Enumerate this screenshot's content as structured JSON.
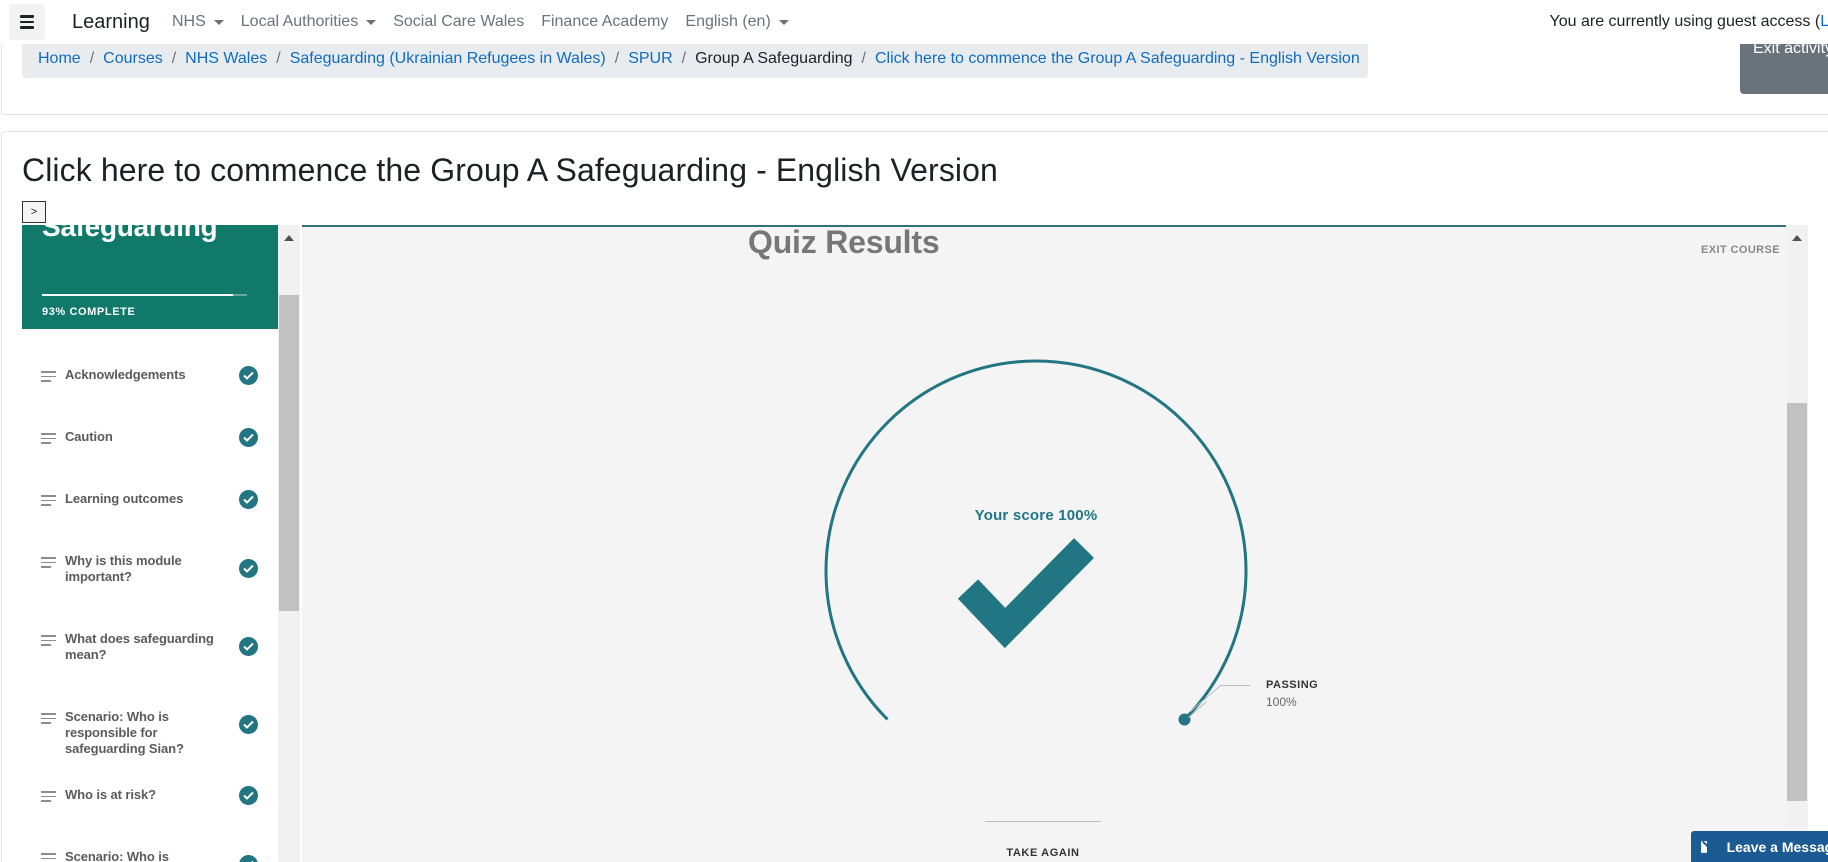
{
  "navbar": {
    "brand": "Learning",
    "menu": [
      "NHS",
      "Local Authorities",
      "Social Care Wales",
      "Finance Academy",
      "English (en)"
    ],
    "guest_text": "You are currently using guest access (",
    "guest_link": "Lo"
  },
  "breadcrumb": [
    "Home",
    "Courses",
    "NHS Wales",
    "Safeguarding (Ukrainian Refugees in Wales)",
    "SPUR",
    "Group A Safeguarding",
    "Click here to commence the Group A Safeguarding - English Version"
  ],
  "exit_activity": "Exit activity",
  "page_title": "Click here to commence the Group A Safeguarding - English Version",
  "toggle_label": ">",
  "course": {
    "title": "Safeguarding",
    "progress": 0.93,
    "complete_text": "93% COMPLETE",
    "lessons": [
      "Acknowledgements",
      "Caution",
      "Learning outcomes",
      "Why is this module important?",
      "What does safeguarding mean?",
      "Scenario: Who is responsible for safeguarding Sian?",
      "Who is at risk?",
      "Scenario: Who is responsible"
    ]
  },
  "quiz": {
    "title": "Quiz Results",
    "exit_course": "EXIT COURSE",
    "score_text": "Your score 100%",
    "score": 1.0,
    "passing_label": "PASSING",
    "passing_value": "100%",
    "take_again": "TAKE AGAIN",
    "accent": "#227583"
  },
  "leave_message": "Leave a Message",
  "colors": {
    "course_header": "#10796a",
    "link": "#0f6cbf",
    "exit_button": "#6a737b",
    "message_button": "#1b5a93"
  }
}
